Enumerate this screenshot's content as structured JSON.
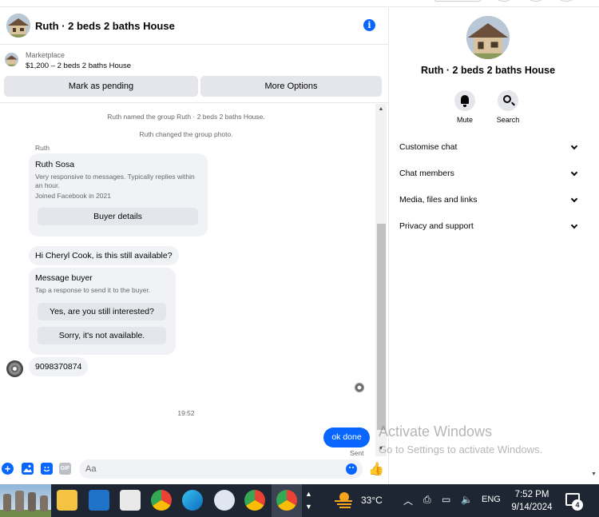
{
  "chat": {
    "title": "Ruth · 2 beds 2 baths House",
    "marketplace_label": "Marketplace",
    "listing": "$1,200 – 2 beds 2 baths House",
    "mark_pending": "Mark as pending",
    "more_options": "More Options"
  },
  "messages": {
    "system1": "Ruth named the group Ruth · 2 beds 2 baths House.",
    "system2": "Ruth changed the group photo.",
    "sender_name": "Ruth",
    "profile_card": {
      "name": "Ruth Sosa",
      "line1": "Very responsive to messages. Typically replies within an hour.",
      "line2": "Joined Facebook in 2021",
      "button": "Buyer details"
    },
    "bubble1": "Hi Cheryl Cook, is this still available?",
    "buyer_card": {
      "title": "Message buyer",
      "subtitle": "Tap a response to send it to the buyer.",
      "option1": "Yes, are you still interested?",
      "option2": "Sorry, it's not available."
    },
    "bubble2": "9098370874",
    "timestamp": "19:52",
    "sent_message": "ok done",
    "sent_status": "Sent"
  },
  "composer": {
    "placeholder": "Aa",
    "gif_label": "GIF"
  },
  "panel": {
    "title": "Ruth · 2 beds 2 baths House",
    "mute_label": "Mute",
    "search_label": "Search",
    "rows": [
      "Customise chat",
      "Chat members",
      "Media, files and links",
      "Privacy and support"
    ]
  },
  "watermark": {
    "line1": "Activate Windows",
    "line2": "Go to Settings to activate Windows."
  },
  "taskbar": {
    "temperature": "33°C",
    "language": "ENG",
    "time": "7:52 PM",
    "date": "9/14/2024",
    "notification_count": "4"
  },
  "colors": {
    "accent": "#0866ff",
    "bubble_bg": "#f0f2f5",
    "button_bg": "#e4e6eb",
    "taskbar_bg": "#1f2633"
  }
}
